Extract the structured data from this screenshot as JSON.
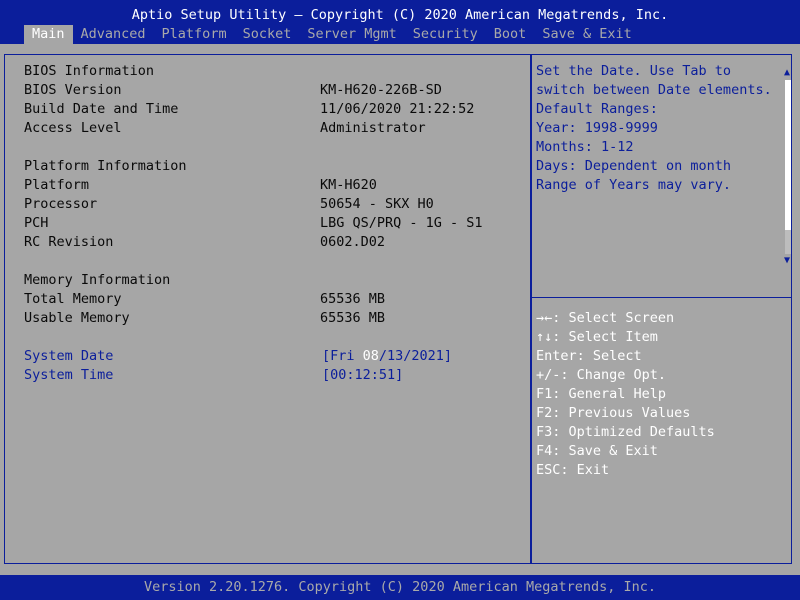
{
  "header": {
    "title": "Aptio Setup Utility – Copyright (C) 2020 American Megatrends, Inc.",
    "tabs": [
      "Main",
      "Advanced",
      "Platform",
      "Socket",
      "Server Mgmt",
      "Security",
      "Boot",
      "Save & Exit"
    ],
    "active_tab": "Main"
  },
  "main": {
    "bios_info": {
      "heading": "BIOS Information",
      "rows": [
        {
          "label": "BIOS Version",
          "value": "KM-H620-226B-SD"
        },
        {
          "label": "Build Date and Time",
          "value": "11/06/2020 21:22:52"
        },
        {
          "label": "Access Level",
          "value": "Administrator"
        }
      ]
    },
    "platform_info": {
      "heading": "Platform Information",
      "rows": [
        {
          "label": "Platform",
          "value": "KM-H620"
        },
        {
          "label": "Processor",
          "value": "50654 - SKX H0"
        },
        {
          "label": "PCH",
          "value": "LBG QS/PRQ - 1G - S1"
        },
        {
          "label": "RC Revision",
          "value": "0602.D02"
        }
      ]
    },
    "memory_info": {
      "heading": "Memory Information",
      "rows": [
        {
          "label": "Total Memory",
          "value": "65536 MB"
        },
        {
          "label": "Usable Memory",
          "value": "65536 MB"
        }
      ]
    },
    "system_date": {
      "label": "System Date",
      "value_prefix": "[Fri ",
      "value_selected": "08",
      "value_suffix": "/13/2021]"
    },
    "system_time": {
      "label": "System Time",
      "value": "[00:12:51]"
    }
  },
  "help": {
    "lines": [
      "Set the Date. Use Tab to",
      "switch between Date elements.",
      "Default Ranges:",
      "Year: 1998-9999",
      "Months: 1-12",
      "Days: Dependent on month",
      "Range of Years may vary."
    ],
    "keys": [
      "→←: Select Screen",
      "↑↓: Select Item",
      "Enter: Select",
      "+/-: Change Opt.",
      "F1: General Help",
      "F2: Previous Values",
      "F3: Optimized Defaults",
      "F4: Save & Exit",
      "ESC: Exit"
    ]
  },
  "footer": {
    "text": "Version 2.20.1276. Copyright (C) 2020 American Megatrends, Inc."
  },
  "colors": {
    "background": "#a6a6a6",
    "bar": "#0b1e9b",
    "highlight": "#ffffff",
    "selectable": "#0b1e9b"
  }
}
